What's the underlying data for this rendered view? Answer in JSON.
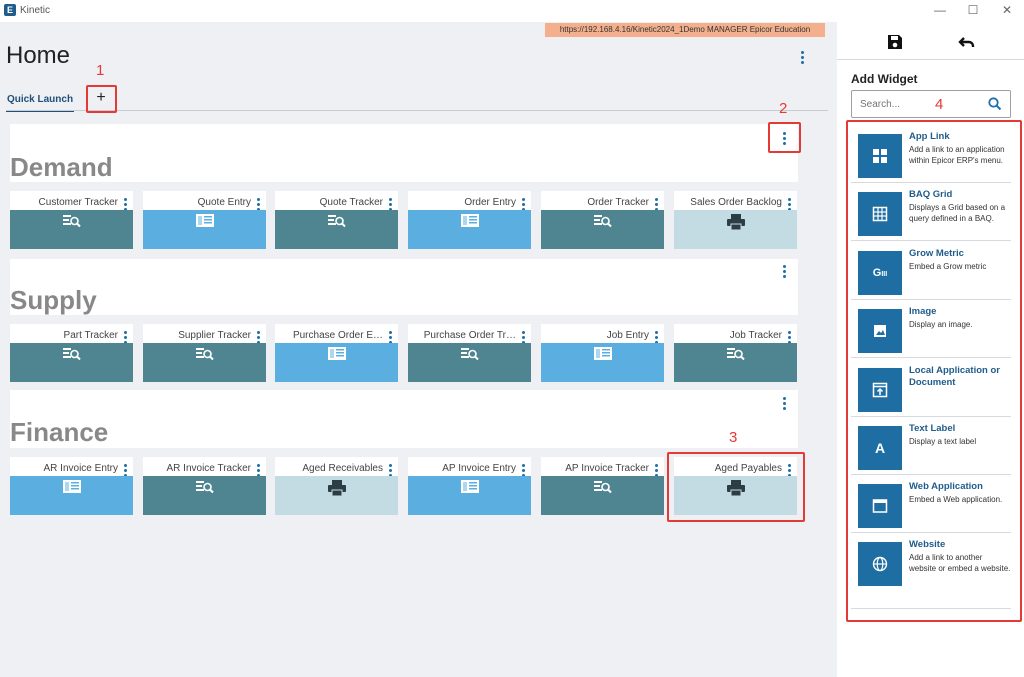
{
  "app": {
    "title": "Kinetic",
    "logo_letter": "E"
  },
  "window_controls": {
    "minimize": "—",
    "maximize": "☐",
    "close": "✕"
  },
  "banner": {
    "text": "https://192.168.4.16/Kinetic2024_1Demo   MANAGER   Epicor Education"
  },
  "header": {
    "title": "Home"
  },
  "tabs": {
    "quick_launch": "Quick Launch",
    "add": "+"
  },
  "callouts": [
    "1",
    "2",
    "3",
    "4"
  ],
  "sections": [
    {
      "title": "Demand",
      "tiles": [
        {
          "label": "Customer Tracker",
          "color": "#4f8591",
          "icon": "tracker-icon"
        },
        {
          "label": "Quote Entry",
          "color": "#5baee0",
          "icon": "entry-icon"
        },
        {
          "label": "Quote Tracker",
          "color": "#4f8591",
          "icon": "tracker-icon"
        },
        {
          "label": "Order Entry",
          "color": "#5baee0",
          "icon": "entry-icon"
        },
        {
          "label": "Order Tracker",
          "color": "#4f8591",
          "icon": "tracker-icon"
        },
        {
          "label": "Sales Order Backlog",
          "color": "#c3dbe3",
          "icon": "printer-icon"
        }
      ]
    },
    {
      "title": "Supply",
      "tiles": [
        {
          "label": "Part Tracker",
          "color": "#4f8591",
          "icon": "tracker-icon"
        },
        {
          "label": "Supplier Tracker",
          "color": "#4f8591",
          "icon": "tracker-icon"
        },
        {
          "label": "Purchase Order E…",
          "color": "#5baee0",
          "icon": "entry-icon"
        },
        {
          "label": "Purchase Order Tr…",
          "color": "#4f8591",
          "icon": "tracker-icon"
        },
        {
          "label": "Job Entry",
          "color": "#5baee0",
          "icon": "entry-icon"
        },
        {
          "label": "Job Tracker",
          "color": "#4f8591",
          "icon": "tracker-icon"
        }
      ]
    },
    {
      "title": "Finance",
      "tiles": [
        {
          "label": "AR Invoice Entry",
          "color": "#5baee0",
          "icon": "entry-icon"
        },
        {
          "label": "AR Invoice Tracker",
          "color": "#4f8591",
          "icon": "tracker-icon"
        },
        {
          "label": "Aged Receivables",
          "color": "#c3dbe3",
          "icon": "printer-icon"
        },
        {
          "label": "AP Invoice Entry",
          "color": "#5baee0",
          "icon": "entry-icon"
        },
        {
          "label": "AP Invoice Tracker",
          "color": "#4f8591",
          "icon": "tracker-icon"
        },
        {
          "label": "Aged Payables",
          "color": "#c3dbe3",
          "icon": "printer-icon"
        }
      ]
    }
  ],
  "sidebar": {
    "save_icon": "save-icon",
    "undo_icon": "undo-icon",
    "heading": "Add Widget",
    "search_placeholder": "Search...",
    "widgets": [
      {
        "title": "App Link",
        "desc": "Add a link to an application within Epicor ERP's menu.",
        "icon": "app-link-icon"
      },
      {
        "title": "BAQ Grid",
        "desc": "Displays a Grid based on a query defined in a BAQ.",
        "icon": "grid-icon"
      },
      {
        "title": "Grow Metric",
        "desc": "Embed a Grow metric",
        "icon": "grow-metric-icon",
        "icon_text": "G𝐈𝐈"
      },
      {
        "title": "Image",
        "desc": "Display an image.",
        "icon": "image-icon"
      },
      {
        "title": "Local Application or Document",
        "desc": "",
        "icon": "local-app-icon"
      },
      {
        "title": "Text Label",
        "desc": "Display a text label",
        "icon": "text-label-icon",
        "icon_text": "A"
      },
      {
        "title": "Web Application",
        "desc": "Embed a Web application.",
        "icon": "web-app-icon"
      },
      {
        "title": "Website",
        "desc": "Add a link to another website or embed a website.",
        "icon": "globe-icon"
      }
    ]
  }
}
